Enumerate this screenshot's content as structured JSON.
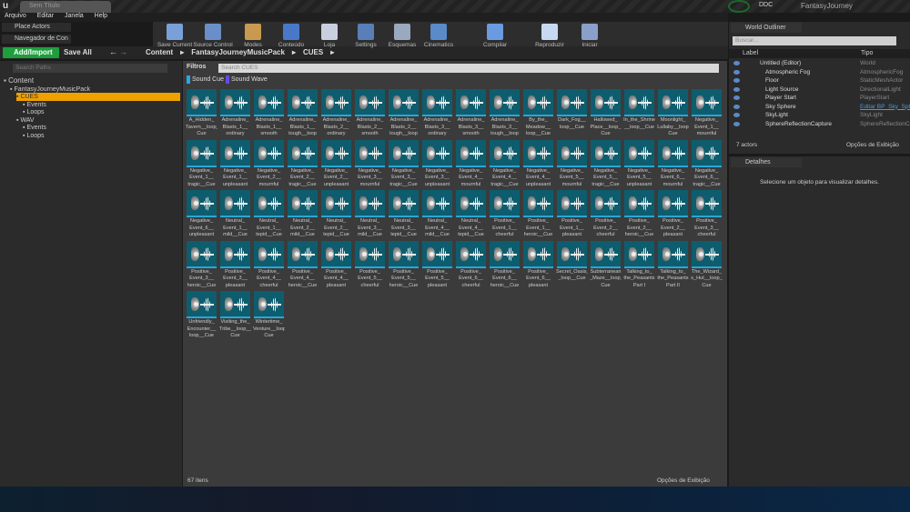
{
  "window": {
    "title": "Sem Título",
    "logo": "u",
    "project": "FantasyJourney",
    "ddc": "DDC"
  },
  "menu": [
    "Arquivo",
    "Editar",
    "Janela",
    "Help"
  ],
  "tabs": {
    "place_actors": "Place Actors",
    "browser": "Navegador de Con"
  },
  "toolbar": [
    {
      "label": "Save Current",
      "color": "#7aa0d8"
    },
    {
      "label": "Source Control",
      "color": "#6a8fc8"
    },
    {
      "label": "Modes",
      "color": "#c89a50"
    },
    {
      "label": "Conteúdo",
      "color": "#4a78c8"
    },
    {
      "label": "Loja",
      "color": "#c8d0e0"
    },
    {
      "label": "Settings",
      "color": "#5a7fb8"
    },
    {
      "label": "Esquemas",
      "color": "#9aa8c0"
    },
    {
      "label": "Cinematics",
      "color": "#5a8ac8"
    },
    {
      "label": "Compilar",
      "color": "#6a9ae0"
    },
    {
      "label": "Reproduzir",
      "color": "#c8d8f0"
    },
    {
      "label": "Iniciar",
      "color": "#8aa0c8"
    }
  ],
  "content_browser": {
    "add_import": "Add/Import",
    "save_all": "Save All",
    "breadcrumb": [
      "Content",
      "FantasyJourneyMusicPack",
      "CUES"
    ],
    "search_paths_placeholder": "Search Paths",
    "filters": "Filtros",
    "search_placeholder": "Search CUES",
    "filter_chips": [
      {
        "label": "Sound Cue",
        "color": "#2aa6e6"
      },
      {
        "label": "Sound Wave",
        "color": "#6a4ae0"
      }
    ],
    "tree": [
      {
        "label": "Content",
        "level": 0
      },
      {
        "label": "FantasyJourneyMusicPack",
        "level": 1
      },
      {
        "label": "CUES",
        "level": 2,
        "selected": true
      },
      {
        "label": "Events",
        "level": 3
      },
      {
        "label": "Loops",
        "level": 3
      },
      {
        "label": "WAV",
        "level": 2
      },
      {
        "label": "Events",
        "level": 3
      },
      {
        "label": "Loops",
        "level": 3
      }
    ],
    "assets": [
      [
        "A_Hidden_",
        "Tavern__loop_",
        "Cue"
      ],
      [
        "Adrenaline_",
        "Blasts_1__",
        "ordinary"
      ],
      [
        "Adrenaline_",
        "Blasts_1__",
        "smooth"
      ],
      [
        "Adrenaline_",
        "Blasts_1__",
        "tough__loop"
      ],
      [
        "Adrenaline_",
        "Blasts_2__",
        "ordinary"
      ],
      [
        "Adrenaline_",
        "Blasts_2__",
        "smooth"
      ],
      [
        "Adrenaline_",
        "Blasts_2__",
        "tough__loop"
      ],
      [
        "Adrenaline_",
        "Blasts_3__",
        "ordinary"
      ],
      [
        "Adrenaline_",
        "Blasts_3__",
        "smooth"
      ],
      [
        "Adrenaline_",
        "Blasts_3__",
        "tough__loop"
      ],
      [
        "By_the_",
        "Meadow__",
        "loop__Cue"
      ],
      [
        "Dark_Fog__",
        "loop__Cue"
      ],
      [
        "Hallowed_",
        "Place__loop_",
        "Cue"
      ],
      [
        "In_the_Shrine",
        "__loop__Cue"
      ],
      [
        "Moonlight_",
        "Lullaby__loop",
        "Cue"
      ],
      [
        "Negative_",
        "Event_1__",
        "mournful"
      ],
      [
        "Negative_",
        "Event_1__",
        "tragic__Cue"
      ],
      [
        "Negative_",
        "Event_1__",
        "unpleasant"
      ],
      [
        "Negative_",
        "Event_2__",
        "mournful"
      ],
      [
        "Negative_",
        "Event_2__",
        "tragic__Cue"
      ],
      [
        "Negative_",
        "Event_2__",
        "unpleasant"
      ],
      [
        "Negative_",
        "Event_3__",
        "mournful"
      ],
      [
        "Negative_",
        "Event_3__",
        "tragic__Cue"
      ],
      [
        "Negative_",
        "Event_3__",
        "unpleasant"
      ],
      [
        "Negative_",
        "Event_4__",
        "mournful"
      ],
      [
        "Negative_",
        "Event_4__",
        "tragic__Cue"
      ],
      [
        "Negative_",
        "Event_4__",
        "unpleasant"
      ],
      [
        "Negative_",
        "Event_5__",
        "mournful"
      ],
      [
        "Negative_",
        "Event_5__",
        "tragic__Cue"
      ],
      [
        "Negative_",
        "Event_5__",
        "unpleasant"
      ],
      [
        "Negative_",
        "Event_6__",
        "mournful"
      ],
      [
        "Negative_",
        "Event_6__",
        "tragic__Cue"
      ],
      [
        "Negative_",
        "Event_6__",
        "unpleasant"
      ],
      [
        "Neutral_",
        "Event_1__",
        "mild__Cue"
      ],
      [
        "Neutral_",
        "Event_1__",
        "tepid__Cue"
      ],
      [
        "Neutral_",
        "Event_2__",
        "mild__Cue"
      ],
      [
        "Neutral_",
        "Event_2__",
        "tepid__Cue"
      ],
      [
        "Neutral_",
        "Event_3__",
        "mild__Cue"
      ],
      [
        "Neutral_",
        "Event_3__",
        "tepid__Cue"
      ],
      [
        "Neutral_",
        "Event_4__",
        "mild__Cue"
      ],
      [
        "Neutral_",
        "Event_4__",
        "tepid__Cue"
      ],
      [
        "Positive_",
        "Event_1__",
        "cheerful"
      ],
      [
        "Positive_",
        "Event_1__",
        "heroic__Cue"
      ],
      [
        "Positive_",
        "Event_1__",
        "pleasant"
      ],
      [
        "Positive_",
        "Event_2__",
        "cheerful"
      ],
      [
        "Positive_",
        "Event_2__",
        "heroic__Cue"
      ],
      [
        "Positive_",
        "Event_2__",
        "pleasant"
      ],
      [
        "Positive_",
        "Event_3__",
        "cheerful"
      ],
      [
        "Positive_",
        "Event_3__",
        "heroic__Cue"
      ],
      [
        "Positive_",
        "Event_3__",
        "pleasant"
      ],
      [
        "Positive_",
        "Event_4__",
        "cheerful"
      ],
      [
        "Positive_",
        "Event_4__",
        "heroic__Cue"
      ],
      [
        "Positive_",
        "Event_4__",
        "pleasant"
      ],
      [
        "Positive_",
        "Event_5__",
        "cheerful"
      ],
      [
        "Positive_",
        "Event_5__",
        "heroic__Cue"
      ],
      [
        "Positive_",
        "Event_5__",
        "pleasant"
      ],
      [
        "Positive_",
        "Event_6__",
        "cheerful"
      ],
      [
        "Positive_",
        "Event_6__",
        "heroic__Cue"
      ],
      [
        "Positive_",
        "Event_6__",
        "pleasant"
      ],
      [
        "Secret_Oasis_",
        "_loop__Cue"
      ],
      [
        "Subterranean",
        "_Maze__loop_",
        "Cue"
      ],
      [
        "Talking_to_",
        "the_Peasants",
        "Part I"
      ],
      [
        "Talking_to_",
        "the_Peasants",
        "Part II"
      ],
      [
        "The_Wizard_",
        "s_Hut__loop_",
        "Cue"
      ],
      [
        "Unfriendly_",
        "Encounter__",
        "loop__Cue"
      ],
      [
        "Visiting_the_",
        "Tribe__loop__",
        "Cue"
      ],
      [
        "Wintertime_",
        "Venture__loop",
        "Cue"
      ]
    ],
    "item_count": "67 itens",
    "view_options": "Opções de Exibição"
  },
  "outliner": {
    "tab": "World Outliner",
    "search_placeholder": "Buscar...",
    "col_label": "Label",
    "col_type": "Tipo",
    "rows": [
      {
        "label": "Untitled (Editor)",
        "type": "World",
        "root": true
      },
      {
        "label": "Atmospheric Fog",
        "type": "AtmosphericFog"
      },
      {
        "label": "Floor",
        "type": "StaticMeshActor"
      },
      {
        "label": "Light Source",
        "type": "DirectionalLight"
      },
      {
        "label": "Player Start",
        "type": "PlayerStart"
      },
      {
        "label": "Sky Sphere",
        "type": "Editar BP_Sky_Sphere",
        "link": true
      },
      {
        "label": "SkyLight",
        "type": "SkyLight"
      },
      {
        "label": "SphereReflectionCapture",
        "type": "SphereReflectionCapture"
      }
    ],
    "actor_count": "7 actors",
    "view_options": "Opções de Exibição"
  },
  "details": {
    "tab": "Detalhes",
    "empty": "Selecione um objeto para visualizar detalhes."
  }
}
